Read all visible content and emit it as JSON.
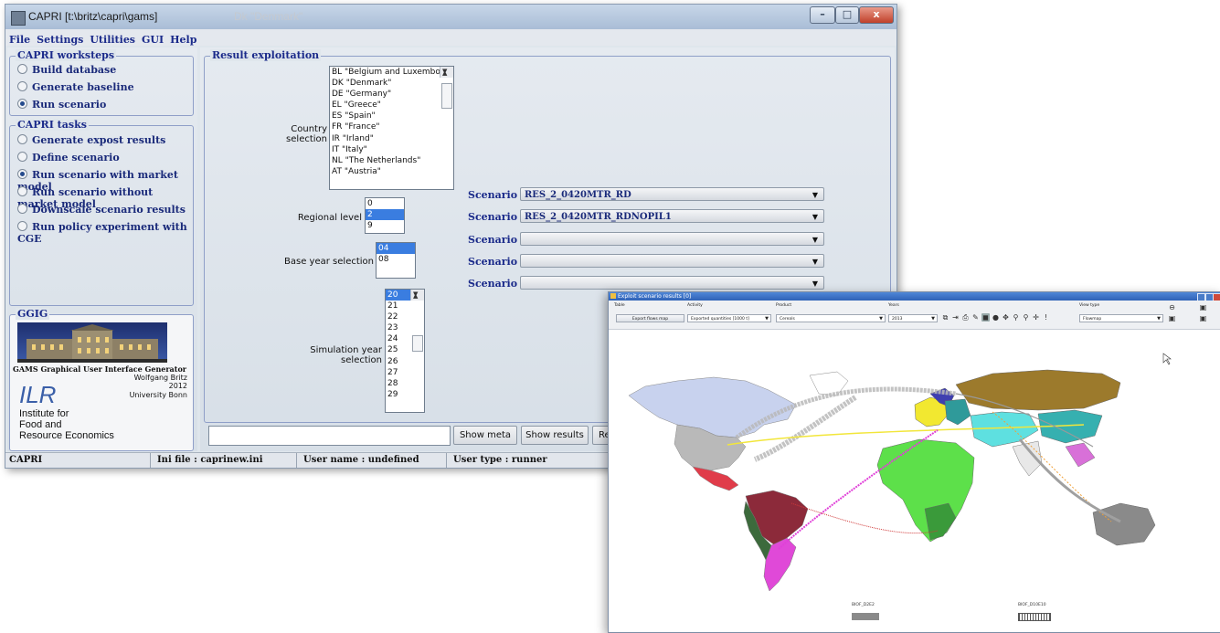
{
  "win1": {
    "title": "CAPRI [t:\\britz\\capri\\gams]",
    "ghost_title": "Dk \"Denmark\"",
    "window_buttons": {
      "minimize": "–",
      "maximize": "□",
      "close": "x"
    },
    "menu": [
      "File",
      "Settings",
      "Utilities",
      "GUI",
      "Help"
    ],
    "worksteps": {
      "legend": "CAPRI worksteps",
      "items": [
        {
          "label": "Build database",
          "selected": false
        },
        {
          "label": "Generate baseline",
          "selected": false
        },
        {
          "label": "Run scenario",
          "selected": true
        }
      ]
    },
    "tasks": {
      "legend": "CAPRI tasks",
      "items": [
        {
          "label": "Generate expost results",
          "selected": false
        },
        {
          "label": "Define scenario",
          "selected": false
        },
        {
          "label": "Run scenario with market model",
          "selected": true
        },
        {
          "label": "Run scenario without market model",
          "selected": false
        },
        {
          "label": "Downscale scenario results",
          "selected": false
        },
        {
          "label": "Run policy experiment with CGE",
          "selected": false
        }
      ]
    },
    "ggig": {
      "legend": "GGIG",
      "caption": "GAMS Graphical User Interface Generator",
      "author": "Wolfgang Britz",
      "year": "2012",
      "university": "University Bonn",
      "ilr": "ILR",
      "institute_lines": [
        "Institute  for",
        "Food and",
        "Resource Economics"
      ]
    },
    "result": {
      "legend": "Result exploitation",
      "country_label": "Country selection",
      "countries": [
        "BL \"Belgium and Luxembourg\"",
        "DK \"Denmark\"",
        "DE \"Germany\"",
        "EL \"Greece\"",
        "ES \"Spain\"",
        "FR \"France\"",
        "IR \"Irland\"",
        "IT \"Italy\"",
        "NL \"The Netherlands\"",
        "AT \"Austria\""
      ],
      "regional_label": "Regional level",
      "regional": [
        "0",
        "2",
        "9"
      ],
      "regional_selected": "2",
      "base_label": "Base year selection",
      "base_years": [
        "04",
        "08"
      ],
      "base_selected": "04",
      "sim_label": "Simulation year selection",
      "sim_years": [
        "20",
        "21",
        "22",
        "23",
        "24",
        "25",
        "26",
        "27",
        "28",
        "29"
      ],
      "sim_selected": "20",
      "scenarios": [
        {
          "label": "Scenario 1",
          "value": "RES_2_0420MTR_RD"
        },
        {
          "label": "Scenario 2",
          "value": "RES_2_0420MTR_RDNOPIL1"
        },
        {
          "label": "Scenario 3",
          "value": ""
        },
        {
          "label": "Scenario 4",
          "value": ""
        },
        {
          "label": "Scenario 5",
          "value": ""
        }
      ],
      "buttons": {
        "show_meta": "Show meta",
        "show_results": "Show results",
        "re": "Re"
      }
    },
    "status": {
      "app": "CAPRI",
      "ini": "Ini file : caprinew.ini",
      "user": "User name : undefined",
      "type": "User type : runner"
    }
  },
  "win2": {
    "title": "Exploit scenario results [0]",
    "toolbar": {
      "table_label": "Table",
      "table_button": "Export flows map",
      "activity_label": "Activity",
      "activity_value": "Exported quantities [1000 t]",
      "product_label": "Product",
      "product_value": "Cereals",
      "years_label": "Years",
      "years_value": "2013",
      "view_label": "View type",
      "view_value": "Flowmap"
    },
    "legend": {
      "left": "BIOF_D2E2",
      "right": "BIOF_D10E10"
    },
    "colors": {
      "flow_gray": "#b8b8b8",
      "flow_yellow": "#f2e63a",
      "flow_magenta": "#e040d8",
      "flow_orange": "#f0a038",
      "flow_red": "#d03a3a"
    }
  }
}
